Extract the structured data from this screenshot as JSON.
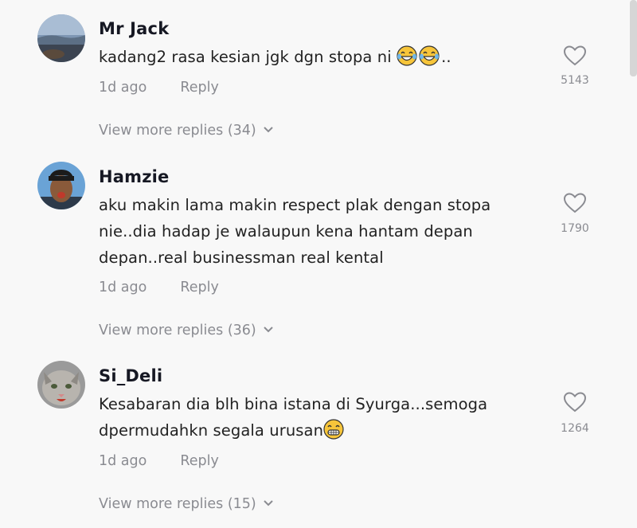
{
  "comments": [
    {
      "username": "Mr Jack",
      "text": "kadang2 rasa kesian jgk dgn stopa ni",
      "text_suffix": "..",
      "emoji": [
        "face-with-tears-of-joy",
        "face-with-tears-of-joy"
      ],
      "time": "1d ago",
      "reply_label": "Reply",
      "likes": "5143",
      "view_more": "View more replies (34)"
    },
    {
      "username": "Hamzie",
      "text": "aku makin lama makin respect plak dengan stopa nie..dia hadap je walaupun kena hantam depan depan..real businessman real kental",
      "time": "1d ago",
      "reply_label": "Reply",
      "likes": "1790",
      "view_more": "View more replies (36)"
    },
    {
      "username": "Si_Deli",
      "text": "Kesabaran dia blh bina istana di Syurga...semoga dpermudahkn segala urusan",
      "emoji": [
        "grinning-face"
      ],
      "time": "1d ago",
      "reply_label": "Reply",
      "likes": "1264",
      "view_more": "View more replies (15)"
    }
  ],
  "colors": {
    "background": "#f8f8f8",
    "username": "#161823",
    "meta": "#8a8b91"
  },
  "icons": {
    "like": "heart-outline-icon",
    "expand": "chevron-down-icon"
  }
}
